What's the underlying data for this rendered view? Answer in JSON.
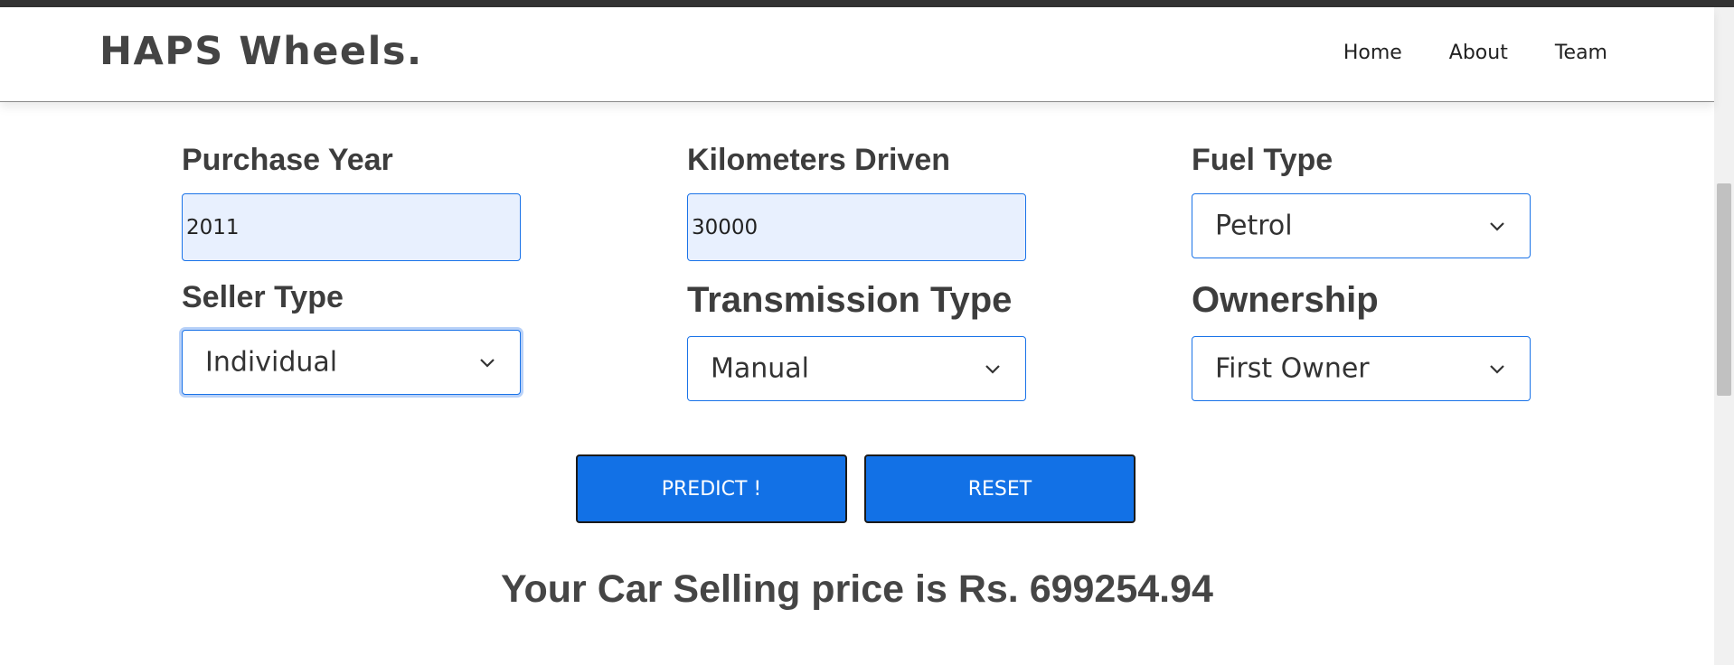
{
  "brand": "HAPS Wheels.",
  "nav": {
    "home": "Home",
    "about": "About",
    "team": "Team"
  },
  "form": {
    "purchase_year": {
      "label": "Purchase Year",
      "value": "2011"
    },
    "kilometers_driven": {
      "label": "Kilometers Driven",
      "value": "30000"
    },
    "fuel_type": {
      "label": "Fuel Type",
      "value": "Petrol"
    },
    "seller_type": {
      "label": "Seller Type",
      "value": "Individual"
    },
    "transmission_type": {
      "label": "Transmission Type",
      "value": "Manual"
    },
    "ownership": {
      "label": "Ownership",
      "value": "First Owner"
    }
  },
  "buttons": {
    "predict": "PREDICT !",
    "reset": "RESET"
  },
  "result": "Your Car Selling price is Rs. 699254.94",
  "colors": {
    "accent": "#1271e6",
    "input_fill": "#e8f0fe",
    "text": "#444444"
  }
}
